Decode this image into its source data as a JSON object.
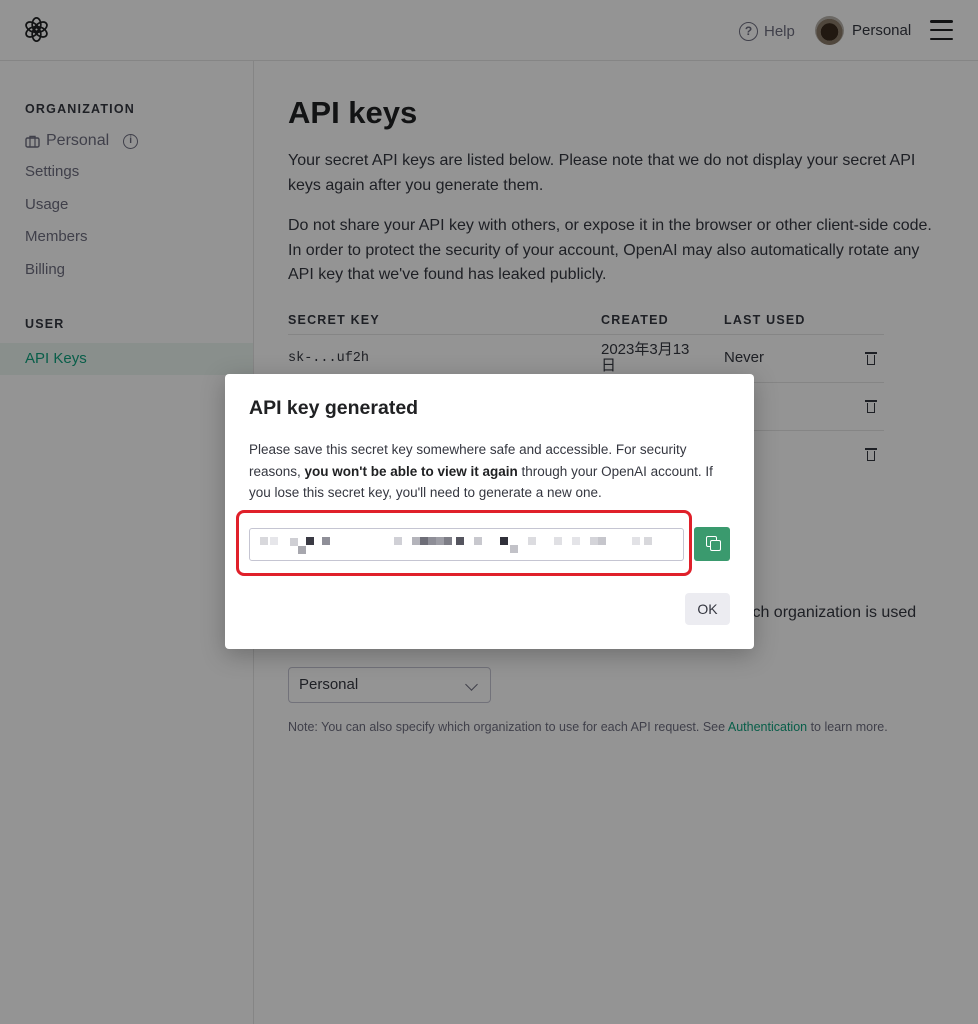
{
  "header": {
    "help_label": "Help",
    "account_label": "Personal"
  },
  "sidebar": {
    "org_heading": "ORGANIZATION",
    "org_name": "Personal",
    "items": [
      "Settings",
      "Usage",
      "Members",
      "Billing"
    ],
    "user_heading": "USER",
    "active_item": "API Keys"
  },
  "main": {
    "title": "API keys",
    "para1": "Your secret API keys are listed below. Please note that we do not display your secret API keys again after you generate them.",
    "para2": "Do not share your API key with others, or expose it in the browser or other client-side code. In order to protect the security of your account, OpenAI may also automatically rotate any API key that we've found has leaked publicly.",
    "table": {
      "headers": [
        "SECRET KEY",
        "CREATED",
        "LAST USED"
      ],
      "rows": [
        {
          "key": "sk-...uf2h",
          "created": "2023年3月13日",
          "last_used": "Never"
        },
        {
          "key": "",
          "created": "",
          "last_used": "ver"
        },
        {
          "key": "",
          "created": "",
          "last_used": "ver"
        }
      ]
    },
    "behind_text": "hich organization is used",
    "org_select_value": "Personal",
    "note_prefix": "Note: You can also specify which organization to use for each API request. See ",
    "note_link": "Authentication",
    "note_suffix": " to learn more."
  },
  "modal": {
    "title": "API key generated",
    "body_part1": "Please save this secret key somewhere safe and accessible. For security reasons, ",
    "body_bold": "you won't be able to view it again",
    "body_part2": " through your OpenAI account. If you lose this secret key, you'll need to generate a new one.",
    "ok_label": "OK"
  },
  "colors": {
    "accent": "#10a37f",
    "copy_button": "#3a9a6e",
    "highlight": "#e0202a"
  }
}
